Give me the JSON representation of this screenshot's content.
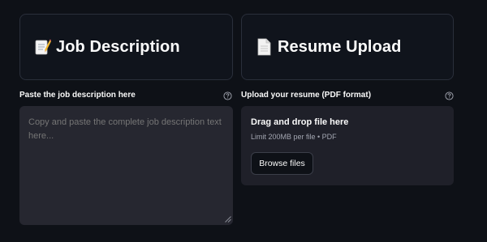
{
  "job_section": {
    "header_title": "Job Description",
    "header_icon": "memo-icon",
    "label": "Paste the job description here",
    "placeholder": "Copy and paste the complete job description text here..."
  },
  "resume_section": {
    "header_title": "Resume Upload",
    "header_icon": "document-icon",
    "label": "Upload your resume (PDF format)",
    "dropzone": {
      "title": "Drag and drop file here",
      "subtitle": "Limit 200MB per file • PDF",
      "button_label": "Browse files"
    }
  },
  "colors": {
    "background": "#0e1117",
    "card_border": "#2a2f3b",
    "input_bg": "#262730",
    "dropzone_bg": "#1f2029"
  }
}
